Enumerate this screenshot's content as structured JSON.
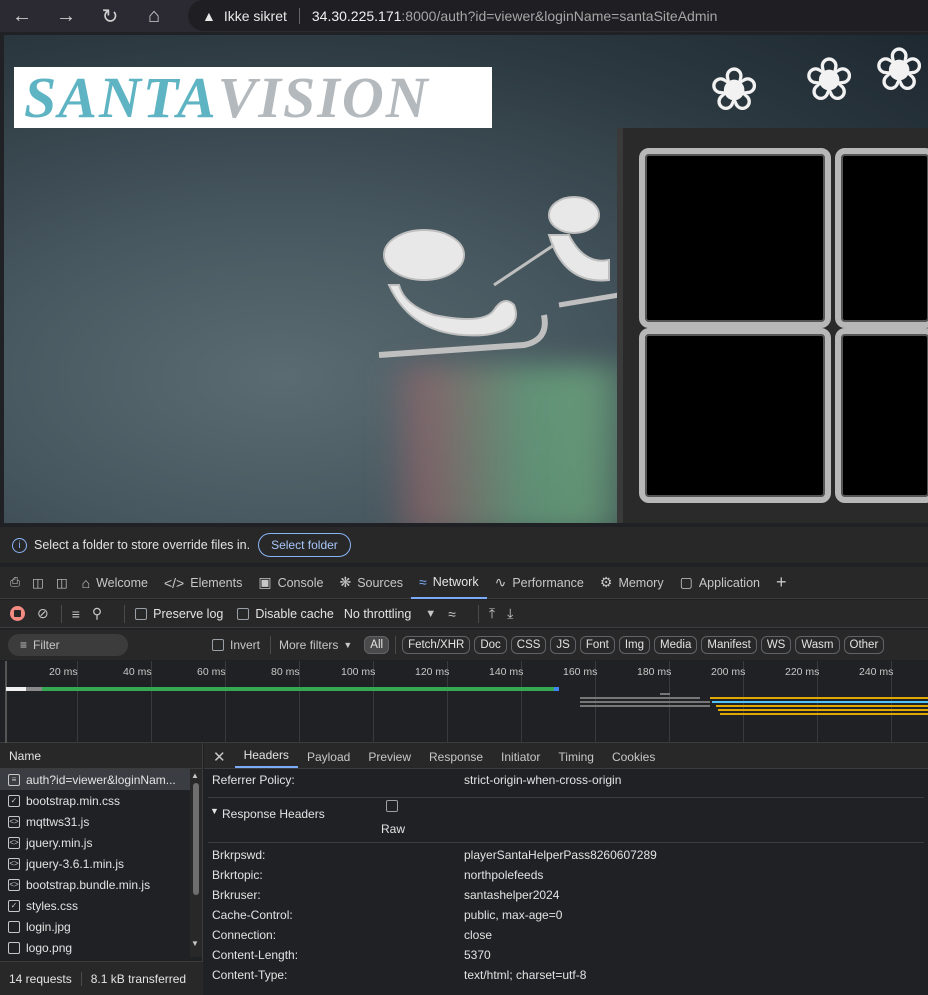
{
  "browser": {
    "warning_label": "Ikke sikret",
    "url_host": "34.30.225.171",
    "url_rest": ":8000/auth?id=viewer&loginName=santaSiteAdmin"
  },
  "page": {
    "logo_part1": "SANTA",
    "logo_part2": "VISION"
  },
  "infobar": {
    "message": "Select a folder to store override files in.",
    "button": "Select folder"
  },
  "devtools_tabs": [
    "Welcome",
    "Elements",
    "Console",
    "Sources",
    "Network",
    "Performance",
    "Memory",
    "Application"
  ],
  "toolbar": {
    "preserve_log": "Preserve log",
    "disable_cache": "Disable cache",
    "throttling": "No throttling"
  },
  "filterbar": {
    "filter_placeholder": "Filter",
    "invert": "Invert",
    "more_filters": "More filters",
    "chips": [
      "All",
      "Fetch/XHR",
      "Doc",
      "CSS",
      "JS",
      "Font",
      "Img",
      "Media",
      "Manifest",
      "WS",
      "Wasm",
      "Other"
    ]
  },
  "timeline": {
    "ticks": [
      "20 ms",
      "40 ms",
      "60 ms",
      "80 ms",
      "100 ms",
      "120 ms",
      "140 ms",
      "160 ms",
      "180 ms",
      "200 ms",
      "220 ms",
      "240 ms"
    ]
  },
  "requests": {
    "header": "Name",
    "items": [
      {
        "name": "auth?id=viewer&loginNam...",
        "icon": "doc-icon"
      },
      {
        "name": "bootstrap.min.css",
        "icon": "css-icon"
      },
      {
        "name": "mqttws31.js",
        "icon": "script-icon"
      },
      {
        "name": "jquery.min.js",
        "icon": "script-icon"
      },
      {
        "name": "jquery-3.6.1.min.js",
        "icon": "script-icon"
      },
      {
        "name": "bootstrap.bundle.min.js",
        "icon": "script-icon"
      },
      {
        "name": "styles.css",
        "icon": "css-icon"
      },
      {
        "name": "login.jpg",
        "icon": "image-icon"
      },
      {
        "name": "logo.png",
        "icon": "image-icon"
      }
    ],
    "count": "14 requests",
    "transferred": "8.1 kB transferred"
  },
  "details": {
    "tabs": [
      "Headers",
      "Payload",
      "Preview",
      "Response",
      "Initiator",
      "Timing",
      "Cookies"
    ],
    "referrer_label": "Referrer Policy:",
    "referrer_value": "strict-origin-when-cross-origin",
    "section_title": "Response Headers",
    "raw_label": "Raw",
    "headers": [
      {
        "name": "Brkrpswd:",
        "value": "playerSantaHelperPass8260607289"
      },
      {
        "name": "Brkrtopic:",
        "value": "northpolefeeds"
      },
      {
        "name": "Brkruser:",
        "value": "santashelper2024"
      },
      {
        "name": "Cache-Control:",
        "value": "public, max-age=0"
      },
      {
        "name": "Connection:",
        "value": "close"
      },
      {
        "name": "Content-Length:",
        "value": "5370"
      },
      {
        "name": "Content-Type:",
        "value": "text/html; charset=utf-8"
      }
    ]
  }
}
